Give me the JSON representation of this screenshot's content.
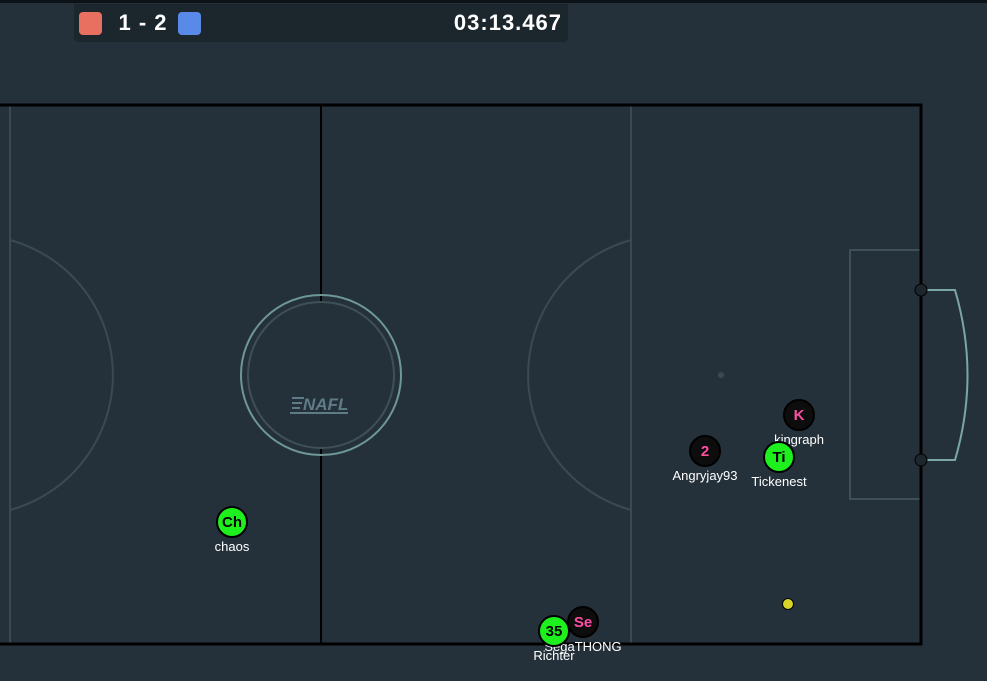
{
  "scoreboard": {
    "score_red": 1,
    "score_blue": 2,
    "score_text": "1 - 2",
    "clock": "03:13.467",
    "red_team_color": "#e87060",
    "blue_team_color": "#5a8ae8"
  },
  "field": {
    "center_logo_text": "NAFL",
    "background_color": "#25313a",
    "line_color": "#000000"
  },
  "players": [
    {
      "id": "chaos",
      "label": "Ch",
      "name": "chaos",
      "team": "green"
    },
    {
      "id": "angryjay93",
      "label": "2",
      "name": "Angryjay93",
      "team": "black"
    },
    {
      "id": "kingraph",
      "label": "K",
      "name": "kingraph",
      "team": "black"
    },
    {
      "id": "tickenest",
      "label": "Ti",
      "name": "Tickenest",
      "team": "green"
    },
    {
      "id": "segathong",
      "label": "Se",
      "name": "SegaTHONG",
      "team": "black"
    },
    {
      "id": "richter",
      "label": "35",
      "name": "Richter",
      "team": "green"
    }
  ],
  "ball": {
    "color": "#d9d428"
  }
}
